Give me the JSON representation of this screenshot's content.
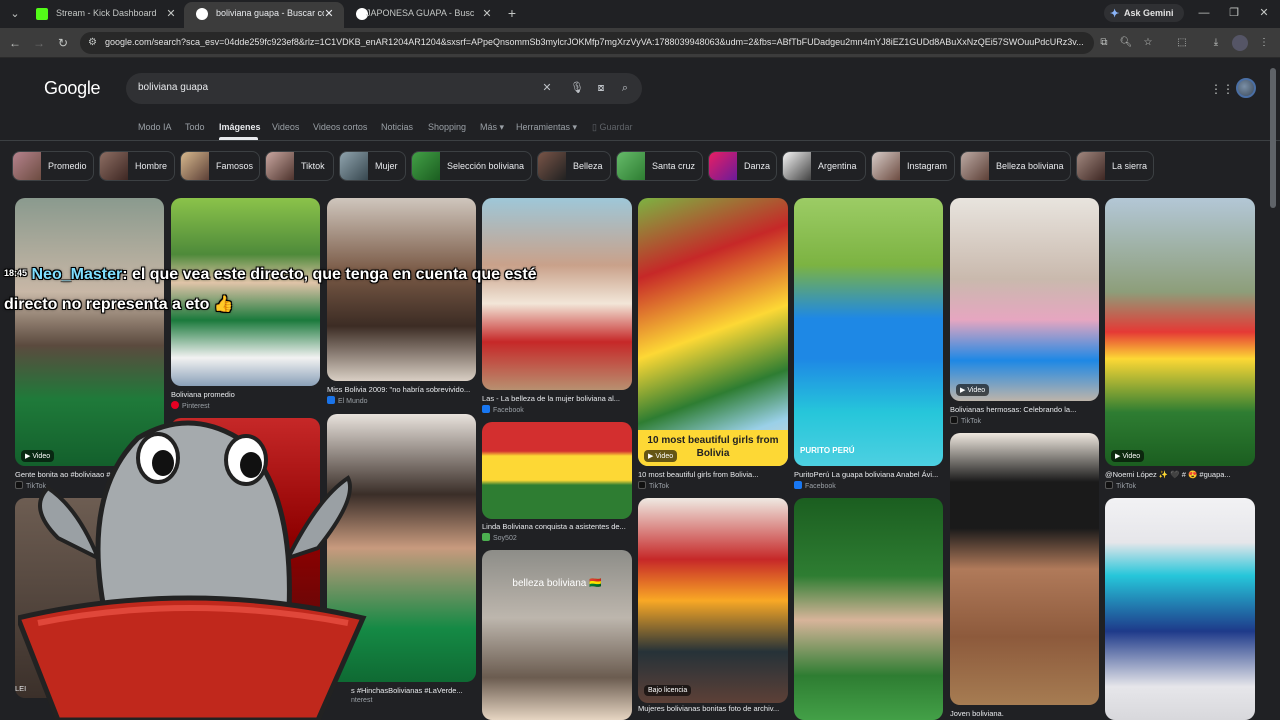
{
  "browser": {
    "tabs": [
      {
        "title": "Stream - Kick Dashboard",
        "favicon_color": "#53fc18"
      },
      {
        "title": "boliviana guapa - Buscar con Google",
        "favicon_color": "#4285f4"
      },
      {
        "title": "JAPONESA GUAPA - Buscar con Google",
        "favicon_color": "#4285f4"
      }
    ],
    "new_tab_icon": "+",
    "gemini_label": "Ask Gemini",
    "url": "google.com/search?sca_esv=04dde259fc923ef8&rlz=1C1VDKB_enAR1204AR1204&sxsrf=APpeQnsommSb3mylcrJOKMfp7mgXrzVyVA:1788039948063&udm=2&fbs=ABfTbFUDadgeu2mn4mYJ8iEZ1GUDd8ABuXxNzQEi57SWOuuPdcURz3v..."
  },
  "google": {
    "logo": "Google",
    "query": "boliviana guapa",
    "filters": [
      "Modo IA",
      "Todo",
      "Imágenes",
      "Videos",
      "Videos cortos",
      "Noticias",
      "Shopping",
      "Más ▾",
      "Herramientas ▾",
      "Guardar"
    ],
    "active_filter": "Imágenes",
    "chips": [
      "Promedio",
      "Hombre",
      "Famosos",
      "Tiktok",
      "Mujer",
      "Selección boliviana",
      "Belleza",
      "Santa cruz",
      "Danza",
      "Argentina",
      "Instagram",
      "Belleza boliviana",
      "La sierra"
    ],
    "video_label": "Video",
    "results": [
      {
        "caption": "Gente bonita ao #boliviaao #er...",
        "source": "TikTok"
      },
      {
        "caption": "Boliviana promedio",
        "source": "Pinterest"
      },
      {
        "caption": "Miss Bolivia 2009: \"no habría sobrevivido...",
        "source": "El Mundo"
      },
      {
        "caption": "Las - La belleza de la mujer boliviana al...",
        "source": "Facebook"
      },
      {
        "caption": "10 most beautiful girls from Bolivia...",
        "source": "TikTok",
        "overlay": "10 most beautiful girls from Bolivia"
      },
      {
        "caption": "PuritoPerú La guapa boliviana Anabel Ávi...",
        "source": "Facebook",
        "overlay": "PURITO PERÚ"
      },
      {
        "caption": "Bolivianas hermosas: Celebrando la...",
        "source": "TikTok"
      },
      {
        "caption": "@Noemi López ✨ 🖤 # 😍 #guapa...",
        "source": "TikTok"
      },
      {
        "caption": "Linda Boliviana conquista a asistentes de...",
        "source": "Soy502"
      },
      {
        "caption": "s #HinchasBolivianas #LaVerde...",
        "source": "nterest"
      },
      {
        "caption": "LEI",
        "source": ""
      },
      {
        "caption": "Mujeres bolivianas bonitas foto de archiv...",
        "source": "",
        "badge": "Bajo licencia"
      },
      {
        "caption": "Joven boliviana.",
        "source": ""
      },
      {
        "caption": "",
        "source": "",
        "overlay": "belleza boliviana 🇧🇴"
      }
    ]
  },
  "stream_overlay": {
    "time": "18:45",
    "user": "Neo_Master",
    "message_line1": ": el que vea este directo, que tenga en cuenta que esté",
    "message_line2": "directo no representa a eto 👍"
  }
}
